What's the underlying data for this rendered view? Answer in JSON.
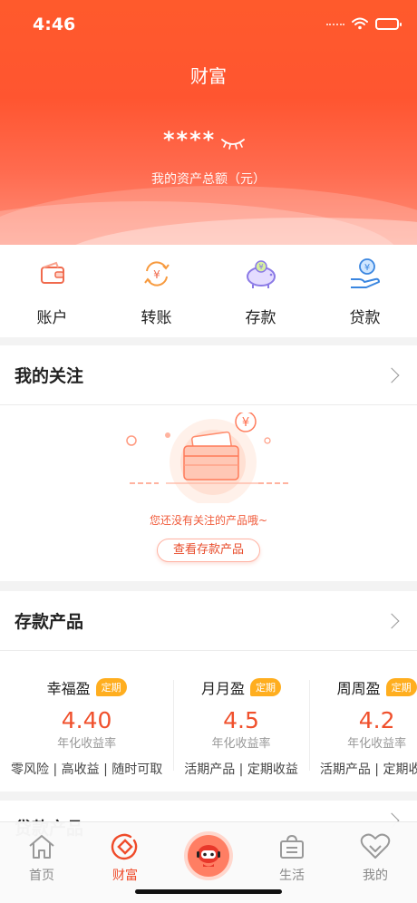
{
  "status_bar": {
    "time": "4:46"
  },
  "header": {
    "title": "财富",
    "asset_mask": "****",
    "asset_label": "我的资产总额（元）"
  },
  "actions": [
    {
      "label": "账户",
      "icon": "wallet-icon"
    },
    {
      "label": "转账",
      "icon": "transfer-icon"
    },
    {
      "label": "存款",
      "icon": "piggy-bank-icon"
    },
    {
      "label": "贷款",
      "icon": "loan-icon"
    }
  ],
  "follow": {
    "title": "我的关注",
    "empty_text": "您还没有关注的产品哦~",
    "button_label": "查看存款产品"
  },
  "deposit": {
    "title": "存款产品",
    "products": [
      {
        "name": "幸福盈",
        "tag": "定期",
        "rate": "4.40",
        "rate_label": "年化收益率",
        "desc": "零风险 | 高收益 | 随时可取"
      },
      {
        "name": "月月盈",
        "tag": "定期",
        "rate": "4.5",
        "rate_label": "年化收益率",
        "desc": "活期产品 | 定期收益"
      },
      {
        "name": "周周盈",
        "tag": "定期",
        "rate": "4.2",
        "rate_label": "年化收益率",
        "desc": "活期产品 | 定期收益"
      }
    ]
  },
  "loan": {
    "title": "贷款产品"
  },
  "tabs": [
    {
      "label": "首页"
    },
    {
      "label": "财富"
    },
    {
      "label": ""
    },
    {
      "label": "生活"
    },
    {
      "label": "我的"
    }
  ],
  "colors": {
    "brand": "#ef4b2a",
    "tag": "#ffae1f",
    "rate": "#f0502c"
  }
}
